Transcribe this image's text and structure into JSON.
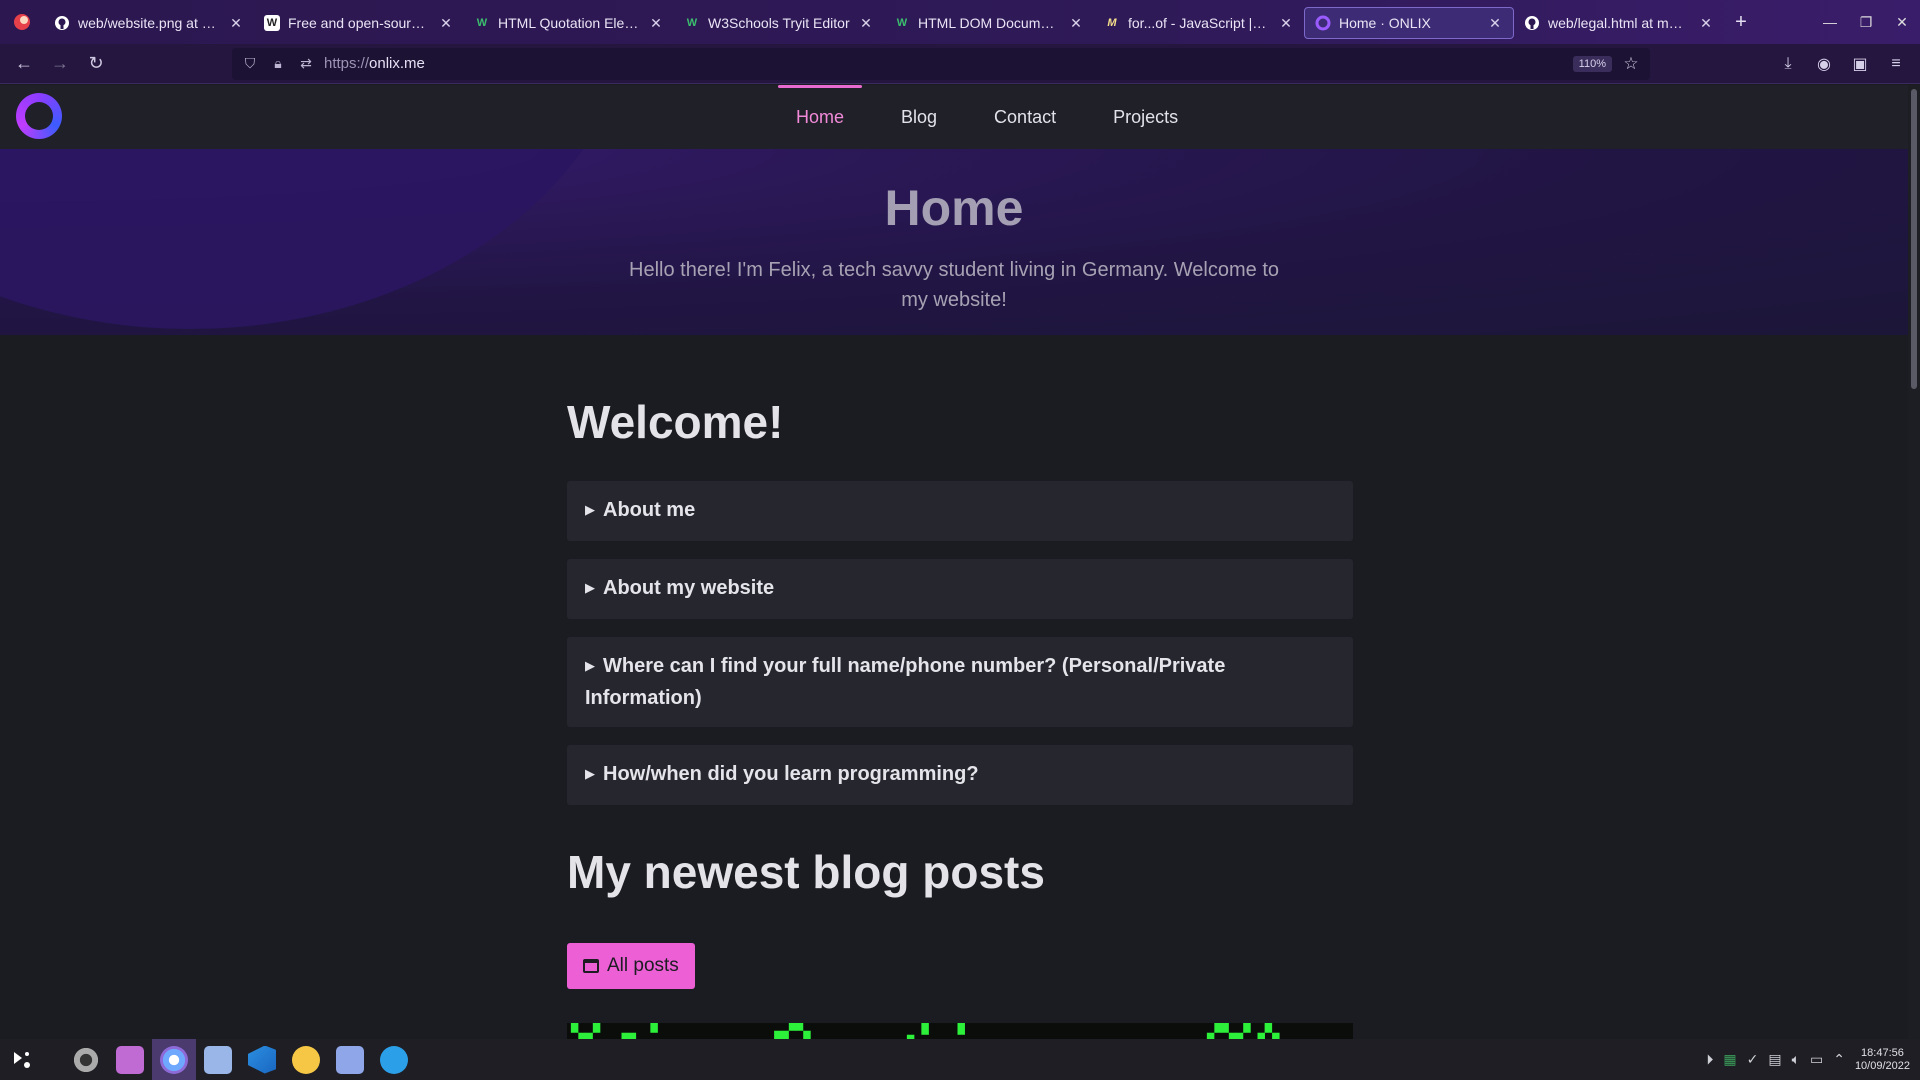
{
  "browser": {
    "tabs": [
      {
        "title": "web/website.png at mas",
        "favicon": "github-icon"
      },
      {
        "title": "Free and open-source so",
        "favicon": "wikipedia-icon"
      },
      {
        "title": "HTML Quotation Elemen",
        "favicon": "w3schools-icon"
      },
      {
        "title": "W3Schools Tryit Editor",
        "favicon": "w3schools-icon"
      },
      {
        "title": "HTML DOM Document g",
        "favicon": "w3schools-icon"
      },
      {
        "title": "for...of - JavaScript | MDN",
        "favicon": "mdn-icon"
      },
      {
        "title": "Home · ONLIX",
        "favicon": "onlix-icon",
        "active": true
      },
      {
        "title": "web/legal.html at maste",
        "favicon": "github-icon"
      }
    ],
    "url_scheme": "https://",
    "url_host": "onlix.me",
    "zoom": "110%"
  },
  "site": {
    "nav": [
      {
        "label": "Home",
        "active": true
      },
      {
        "label": "Blog"
      },
      {
        "label": "Contact"
      },
      {
        "label": "Projects"
      }
    ],
    "hero": {
      "title": "Home",
      "subtitle": "Hello there! I'm Felix, a tech savvy student living in Germany. Welcome to my website!"
    },
    "welcome_title": "Welcome!",
    "faq": [
      "About me",
      "About my website",
      "Where can I find your full name/phone number? (Personal/Private Information)",
      "How/when did you learn programming?"
    ],
    "blog_title": "My newest blog posts",
    "all_posts_label": "All posts"
  },
  "taskbar": {
    "time": "18:47:56",
    "date": "10/09/2022"
  },
  "colors": {
    "accent": "#ec5fd5",
    "nav_active": "#f08ad8",
    "hero_bg": "#2b1858",
    "page_bg": "#1b1b22"
  }
}
